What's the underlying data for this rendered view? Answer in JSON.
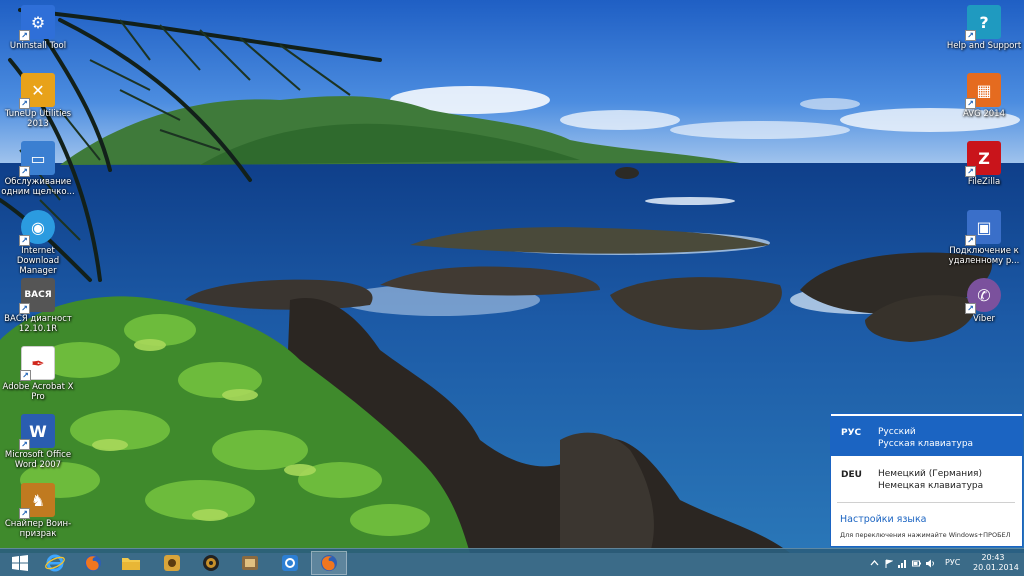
{
  "desktop": {
    "icons_left": [
      {
        "label": "Uninstall Tool",
        "icon": "uninstall-tool-icon",
        "color": "#2f6fd8"
      },
      {
        "label": "TuneUp Utilities 2013",
        "icon": "tuneup-utilities-icon",
        "color": "#e8a21a"
      },
      {
        "label": "Обслуживание одним щелчко...",
        "icon": "one-click-maintenance-icon",
        "color": "#3b7fd1"
      },
      {
        "label": "Internet Download Manager",
        "icon": "idm-globe-icon",
        "color": "#2b9be0"
      },
      {
        "label": "ВАСЯ диагност 12.10.1R",
        "icon": "vasya-diagnost-icon",
        "color": "#555555",
        "glyph": "ВАСЯ"
      },
      {
        "label": "Adobe Acrobat X Pro",
        "icon": "adobe-acrobat-icon",
        "color": "#ffffff"
      },
      {
        "label": "Microsoft Office Word 2007",
        "icon": "word-icon",
        "color": "#2a5db0"
      },
      {
        "label": "Снайпер Воин-призрак",
        "icon": "sniper-game-icon",
        "color": "#c07a20"
      }
    ],
    "icons_right": [
      {
        "label": "Help and Support",
        "icon": "help-support-icon",
        "color": "#1f9ac0"
      },
      {
        "label": "AVG 2014",
        "icon": "avg-antivirus-icon",
        "color": "#e56b1f"
      },
      {
        "label": "FileZilla",
        "icon": "filezilla-icon",
        "color": "#c9141b"
      },
      {
        "label": "Подключение к удаленному р...",
        "icon": "remote-desktop-icon",
        "color": "#3a6fc9"
      },
      {
        "label": "Viber",
        "icon": "viber-icon",
        "color": "#7b519d"
      }
    ]
  },
  "language_flyout": {
    "languages": [
      {
        "code": "РУС",
        "name": "Русский",
        "keyboard": "Русская клавиатура",
        "active": true
      },
      {
        "code": "DEU",
        "name": "Немецкий (Германия)",
        "keyboard": "Немецкая клавиатура",
        "active": false
      }
    ],
    "settings_link": "Настройки языка",
    "hint": "Для переключения нажимайте Windows+ПРОБЕЛ",
    "accent_color": "#1b64c2"
  },
  "taskbar": {
    "pinned": [
      {
        "name": "start-button",
        "icon": "windows-logo-icon"
      },
      {
        "name": "taskbar-internet-explorer",
        "icon": "internet-explorer-icon"
      },
      {
        "name": "taskbar-firefox",
        "icon": "firefox-icon"
      },
      {
        "name": "taskbar-file-explorer",
        "icon": "folder-icon"
      },
      {
        "name": "taskbar-app-4",
        "icon": "media-app-icon"
      },
      {
        "name": "taskbar-app-5",
        "icon": "speaker-app-icon"
      },
      {
        "name": "taskbar-app-6",
        "icon": "film-app-icon"
      },
      {
        "name": "taskbar-app-7",
        "icon": "settings-app-icon"
      },
      {
        "name": "taskbar-firefox-running",
        "icon": "firefox-icon"
      }
    ],
    "tray": {
      "language": "РУС",
      "time": "20:43",
      "date": "20.01.2014"
    }
  }
}
